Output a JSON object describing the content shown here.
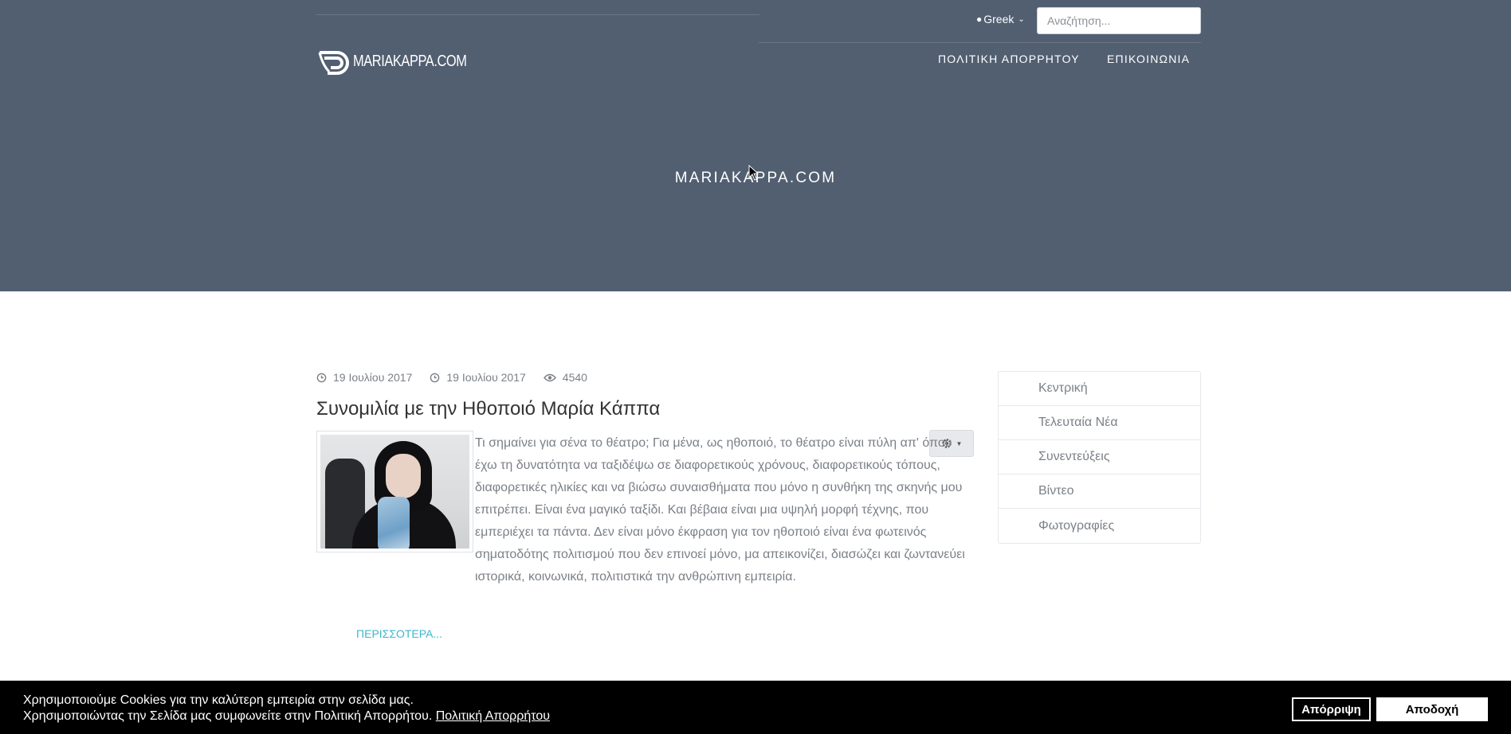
{
  "header": {
    "logo_text": "MARIAKAPPA.COM",
    "language": "Greek",
    "search_placeholder": "Αναζήτηση...",
    "nav": [
      "ΠΟΛΙΤΙΚΗ ΑΠΟΡΡΗΤΟΥ",
      "ΕΠΙΚΟΙΝΩΝΙΑ"
    ],
    "hero_title": "MARIAKAPPA.COM",
    "background_color": "#525f71"
  },
  "article": {
    "created": "19 Ιουλίου 2017",
    "modified": "19 Ιουλίου 2017",
    "hits": "4540",
    "title": "Συνομιλία με την Ηθοποιό Μαρία Κάππα",
    "body": "Τι σημαίνει για σένα το θέατρο;  Για μένα, ως ηθοποιό, το θέατρο είναι πύλη απ' όπου έχω τη δυνατότητα να ταξιδέψω σε διαφορετικούς χρόνους, διαφορετικούς τόπους, διαφορετικές ηλικίες και να βιώσω συναισθήματα που μόνο η συνθήκη της σκηνής μου επιτρέπει. Είναι ένα μαγικό ταξίδι. Και βέβαια είναι μια υψηλή μορφή τέχνης, που εμπεριέχει τα πάντα. Δεν είναι μόνο έκφραση για τον ηθοποιό είναι ένα φωτεινός σηματοδότης πολιτισμού που δεν επινοεί μόνο, μα απεικονίζει, διασώζει και ζωντανεύει ιστορικά, κοινωνικά, πολιτιστικά την ανθρώπινη εμπειρία.",
    "read_more": "ΠΕΡΙΣΣΟΤΕΡΑ...",
    "link_color": "#3cb6ce"
  },
  "sidebar": {
    "items": [
      "Κεντρική",
      "Τελευταία Νέα",
      "Συνεντεύξεις",
      "Βίντεο",
      "Φωτογραφίες"
    ]
  },
  "cookie": {
    "line1": "Χρησιμοποιούμε Cookies για την καλύτερη εμπειρία στην σελίδα μας.",
    "line2": "Χρησιμοποιώντας την Σελίδα μας συμφωνείτε στην Πολιτική Απορρήτου.",
    "policy_link": "Πολιτική Απορρήτου",
    "reject": "Απόρριψη",
    "accept": "Αποδοχή"
  }
}
